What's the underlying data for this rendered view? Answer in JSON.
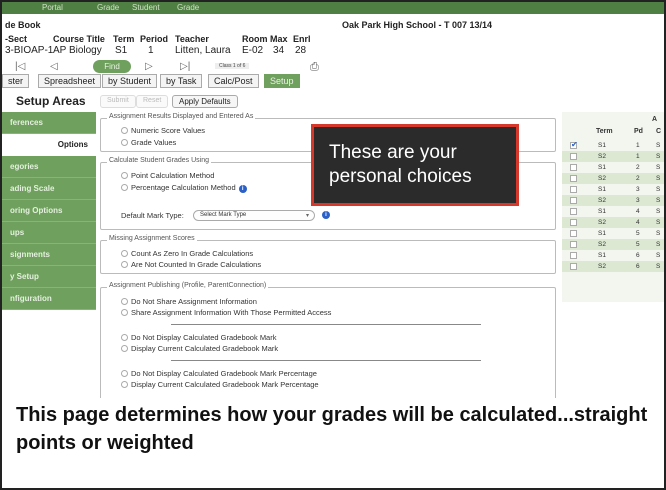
{
  "topbar": {
    "items": [
      "Portal",
      "Grade",
      "Student",
      "Grade"
    ]
  },
  "header": {
    "gradebook_title": "de Book",
    "school_label": "Oak Park High School - T 007 13/14"
  },
  "course_table": {
    "headers": [
      "-Sect",
      "Course Title",
      "Term",
      "Period",
      "Teacher",
      "Room",
      "Max",
      "Enrl"
    ],
    "row": [
      "3-BIOAP-1",
      "AP Biology",
      "S1",
      "1",
      "Litten, Laura",
      "E-02",
      "34",
      "28"
    ]
  },
  "nav": {
    "find_label": "Find",
    "class_of": "Class 1 of 6"
  },
  "tabs": [
    "ster",
    "Spreadsheet",
    "by Student",
    "by Task",
    "Calc/Post",
    "Setup"
  ],
  "setup_areas": {
    "title": "Setup Areas",
    "submit_label": "Submit",
    "reset_label": "Reset",
    "apply_defaults_label": "Apply Defaults"
  },
  "sidebar": {
    "items": [
      "ferences",
      "Options",
      "egories",
      "ading Scale",
      "oring Options",
      "ups",
      "signments",
      "y Setup",
      "nfiguration"
    ]
  },
  "sections": {
    "results_display": {
      "legend": "Assignment Results Displayed and Entered As",
      "options": [
        "Numeric Score Values",
        "Grade Values"
      ]
    },
    "calculate": {
      "legend": "Calculate Student Grades Using",
      "options": [
        "Point Calculation Method",
        "Percentage Calculation Method"
      ],
      "default_mark_label": "Default Mark Type:",
      "default_mark_value": "Select Mark Type"
    },
    "missing": {
      "legend": "Missing Assignment Scores",
      "options": [
        "Count As Zero In Grade Calculations",
        "Are Not Counted In Grade Calculations"
      ]
    },
    "publishing": {
      "legend": "Assignment Publishing (Profile, ParentConnection)",
      "options": [
        "Do Not Share Assignment Information",
        "Share Assignment Information With Those Permitted Access",
        "Do Not Display Calculated Gradebook Mark",
        "Display Current Calculated Gradebook Mark",
        "Do Not Display Calculated Gradebook Mark Percentage",
        "Display Current Calculated Gradebook Mark Percentage"
      ]
    }
  },
  "right_panel": {
    "corner_label": "A",
    "headers": [
      "Term",
      "Pd",
      "C"
    ],
    "rows": [
      {
        "checked": true,
        "term": "S1",
        "pd": "1",
        "c": "S"
      },
      {
        "checked": false,
        "term": "S2",
        "pd": "1",
        "c": "S"
      },
      {
        "checked": false,
        "term": "S1",
        "pd": "2",
        "c": "S"
      },
      {
        "checked": false,
        "term": "S2",
        "pd": "2",
        "c": "S"
      },
      {
        "checked": false,
        "term": "S1",
        "pd": "3",
        "c": "S"
      },
      {
        "checked": false,
        "term": "S2",
        "pd": "3",
        "c": "S"
      },
      {
        "checked": false,
        "term": "S1",
        "pd": "4",
        "c": "S"
      },
      {
        "checked": false,
        "term": "S2",
        "pd": "4",
        "c": "S"
      },
      {
        "checked": false,
        "term": "S1",
        "pd": "5",
        "c": "S"
      },
      {
        "checked": false,
        "term": "S2",
        "pd": "5",
        "c": "S"
      },
      {
        "checked": false,
        "term": "S1",
        "pd": "6",
        "c": "S"
      },
      {
        "checked": false,
        "term": "S2",
        "pd": "6",
        "c": "S"
      }
    ]
  },
  "callout": {
    "line1": "These are your",
    "line2": "personal choices"
  },
  "caption": {
    "text": "This page determines how your grades will be calculated...straight points or weighted"
  },
  "colors": {
    "green": "#6fa05e",
    "dark_green": "#4f7f42",
    "callout_border": "#d6382c",
    "info_blue": "#2a60c8"
  },
  "icons": [
    "first-icon",
    "prev-icon",
    "next-icon",
    "last-icon",
    "printer-icon",
    "info-icon",
    "checkmark-icon"
  ]
}
